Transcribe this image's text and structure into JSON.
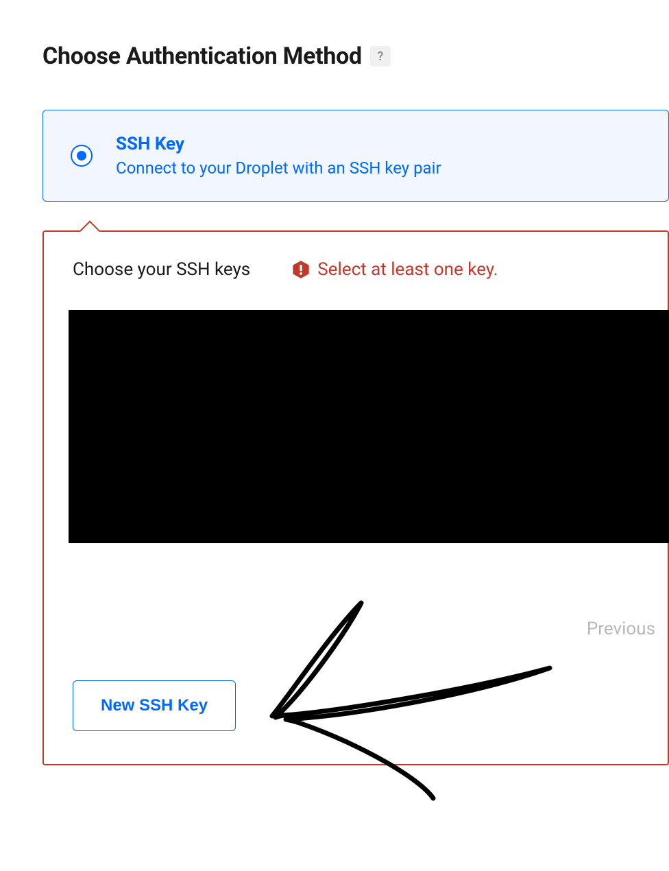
{
  "header": {
    "title": "Choose Authentication Method",
    "help_label": "?"
  },
  "auth_option": {
    "title": "SSH Key",
    "description": "Connect to your Droplet with an SSH key pair"
  },
  "ssh_panel": {
    "label": "Choose your SSH keys",
    "alert_text": "Select at least one key."
  },
  "pagination": {
    "previous": "Previous"
  },
  "buttons": {
    "new_ssh_key": "New SSH Key"
  }
}
